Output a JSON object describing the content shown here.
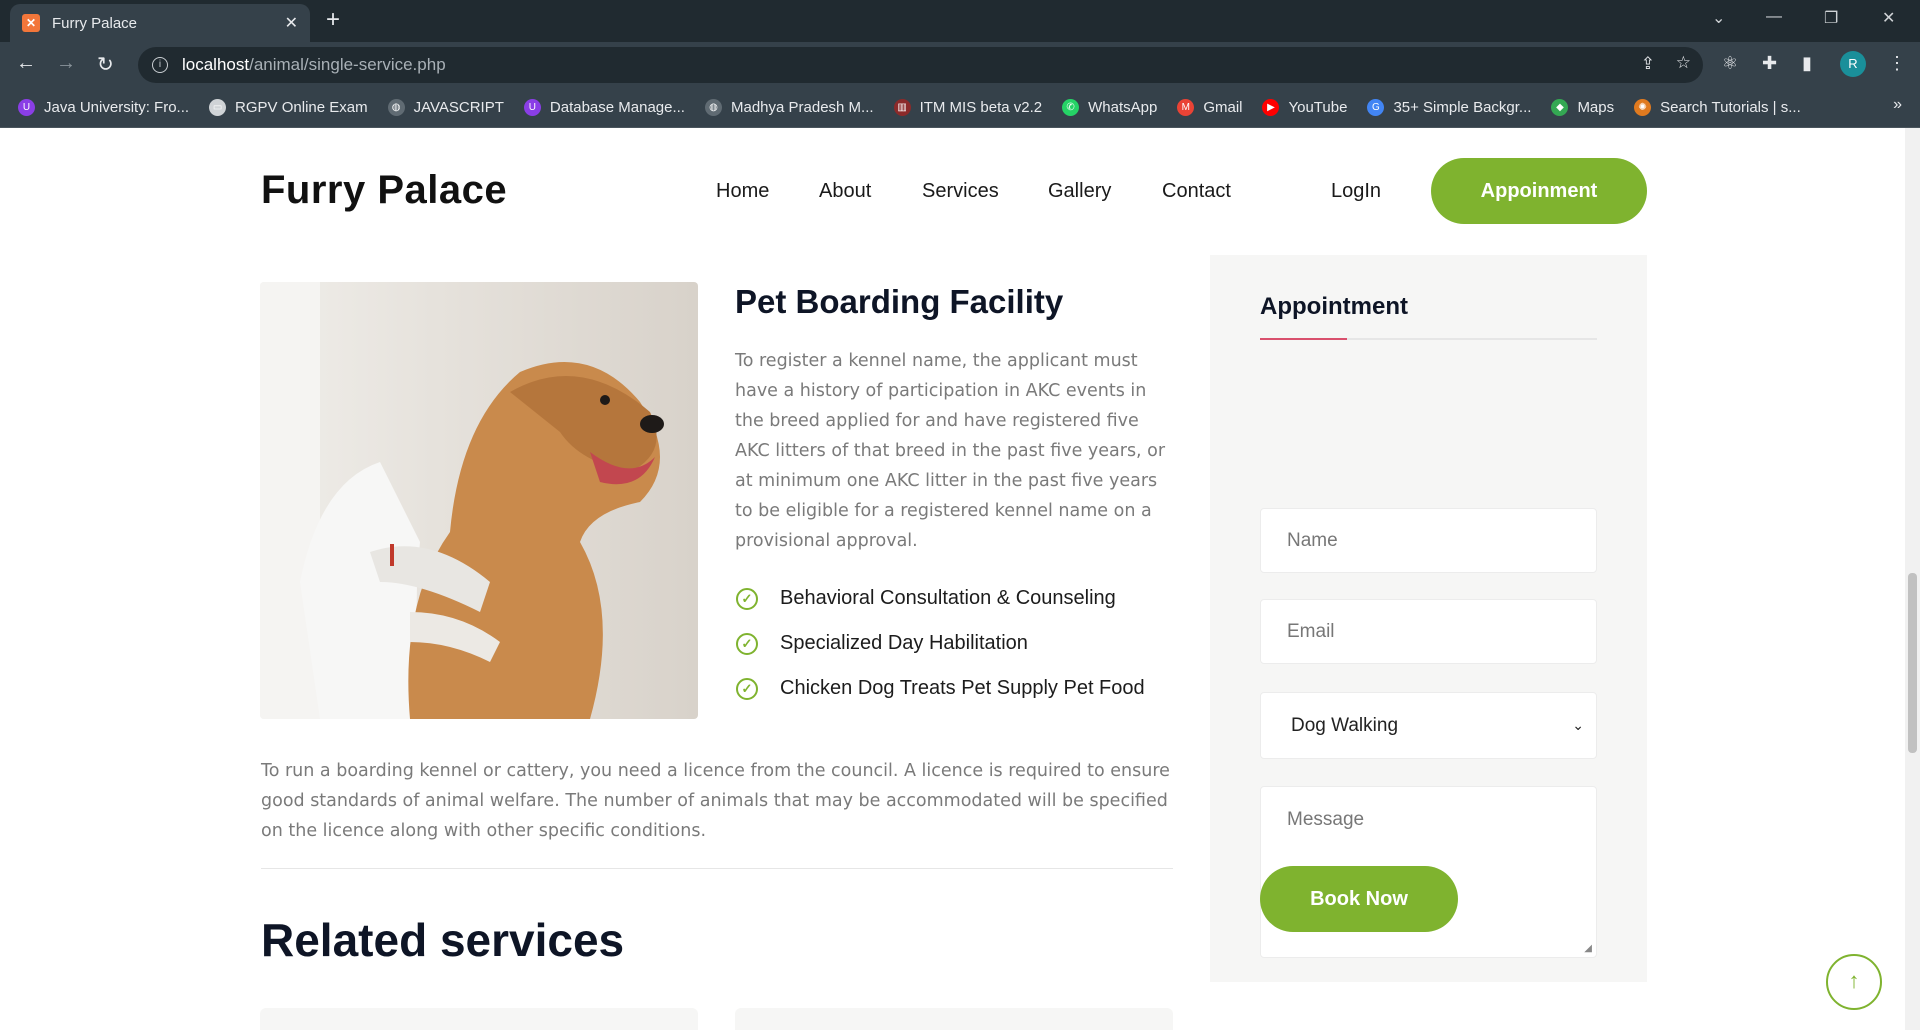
{
  "browser": {
    "tab_title": "Furry Palace",
    "url_host": "localhost",
    "url_path": "/animal/single-service.php",
    "profile_initial": "R",
    "bookmarks": [
      {
        "label": "Java University: Fro...",
        "icon": "university-icon",
        "color": "#8a3ee6"
      },
      {
        "label": "RGPV Online Exam",
        "icon": "monitor-icon",
        "color": "#cfd3d6"
      },
      {
        "label": "JAVASCRIPT",
        "icon": "globe-icon",
        "color": "#606b73"
      },
      {
        "label": "Database Manage...",
        "icon": "university-icon",
        "color": "#8a3ee6"
      },
      {
        "label": "Madhya Pradesh M...",
        "icon": "globe-icon",
        "color": "#606b73"
      },
      {
        "label": "ITM MIS beta v2.2",
        "icon": "itm-icon",
        "color": "#8b2a2a"
      },
      {
        "label": "WhatsApp",
        "icon": "whatsapp-icon",
        "color": "#25d366"
      },
      {
        "label": "Gmail",
        "icon": "gmail-icon",
        "color": "#ea4335"
      },
      {
        "label": "YouTube",
        "icon": "youtube-icon",
        "color": "#ff0000"
      },
      {
        "label": "35+ Simple Backgr...",
        "icon": "google-icon",
        "color": "#4285f4"
      },
      {
        "label": "Maps",
        "icon": "maps-icon",
        "color": "#34a853"
      },
      {
        "label": "Search Tutorials | s...",
        "icon": "tutorials-icon",
        "color": "#e07a1f"
      }
    ]
  },
  "site": {
    "logo": "Furry Palace",
    "nav": [
      "Home",
      "About",
      "Services",
      "Gallery",
      "Contact",
      "LogIn"
    ],
    "cta": "Appoinment",
    "accent": "#7fb32f"
  },
  "service": {
    "title": "Pet Boarding Facility",
    "description": "To register a kennel name, the applicant must have a history of participation in AKC events in the breed applied for and have registered five AKC litters of that breed in the past five years, or at minimum one AKC litter in the past five years to be eligible for a registered kennel name on a provisional approval.",
    "features": [
      "Behavioral Consultation & Counseling",
      "Specialized Day Habilitation",
      "Chicken Dog Treats Pet Supply Pet Food"
    ],
    "details": "To run a boarding kennel or cattery, you need a licence from the council. A licence is required to ensure good standards of animal welfare. The number of animals that may be accommodated will be specified on the licence along with other specific conditions.",
    "related_title": "Related services"
  },
  "appointment": {
    "title": "Appointment",
    "name_placeholder": "Name",
    "email_placeholder": "Email",
    "service_selected": "Dog Walking",
    "message_placeholder": "Message",
    "submit": "Book Now"
  }
}
